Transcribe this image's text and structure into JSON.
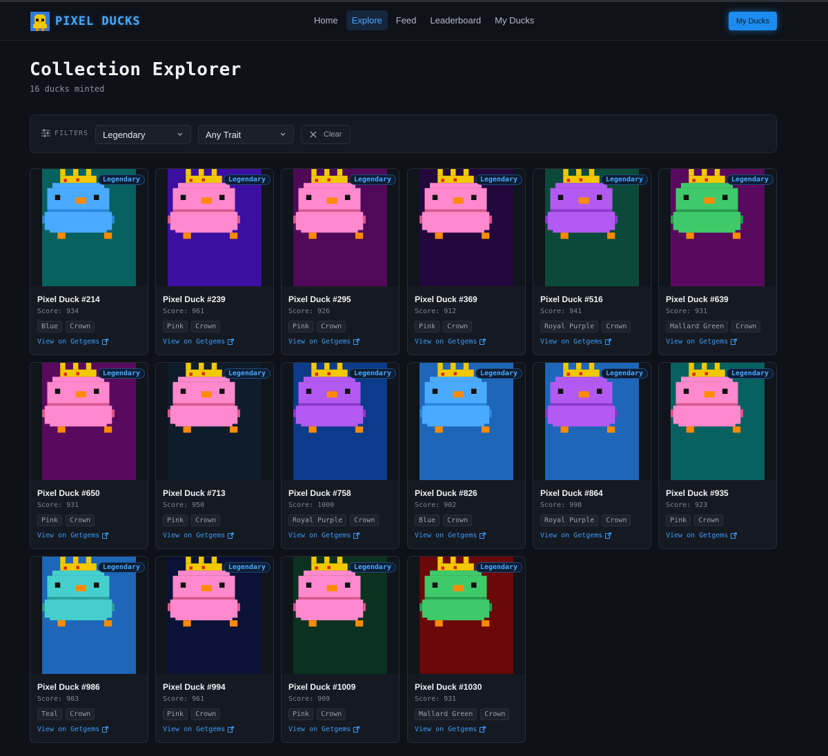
{
  "brand": {
    "name": "PIXEL DUCKS",
    "icon": "duck-logo-icon"
  },
  "nav": {
    "items": [
      {
        "label": "Home",
        "active": false
      },
      {
        "label": "Explore",
        "active": true
      },
      {
        "label": "Feed",
        "active": false
      },
      {
        "label": "Leaderboard",
        "active": false
      },
      {
        "label": "My Ducks",
        "active": false
      }
    ],
    "cta_label": "My Ducks"
  },
  "page": {
    "title": "Collection Explorer",
    "subtitle": "16 ducks minted"
  },
  "filters": {
    "label": "FILTERS",
    "rarity_value": "Legendary",
    "trait_value": "Any Trait",
    "clear_label": "Clear"
  },
  "colors": {
    "accent": "#4aa8ff",
    "background": "#0e1117",
    "card": "#151a22",
    "crown": "#f2c800",
    "beak": "#ff8a00"
  },
  "ducks": [
    {
      "name": "Pixel Duck #214",
      "score": "Score: 934",
      "tags": [
        "Blue",
        "Crown"
      ],
      "badge": "Legendary",
      "link": "View on Getgems",
      "bg": "#06615f",
      "body": "#4aaaff",
      "belt": "#2b87d8",
      "feet": "#ff8a00"
    },
    {
      "name": "Pixel Duck #239",
      "score": "Score: 961",
      "tags": [
        "Pink",
        "Crown"
      ],
      "badge": "Legendary",
      "link": "View on Getgems",
      "bg": "#3b0fa0",
      "body": "#ff89cc",
      "belt": "#d9578f",
      "feet": "#ff8a00"
    },
    {
      "name": "Pixel Duck #295",
      "score": "Score: 926",
      "tags": [
        "Pink",
        "Crown"
      ],
      "badge": "Legendary",
      "link": "View on Getgems",
      "bg": "#500958",
      "body": "#ff89cc",
      "belt": "#d9578f",
      "feet": "#ff8a00"
    },
    {
      "name": "Pixel Duck #369",
      "score": "Score: 912",
      "tags": [
        "Pink",
        "Crown"
      ],
      "badge": "Legendary",
      "link": "View on Getgems",
      "bg": "#22083c",
      "body": "#ff89cc",
      "belt": "#d9578f",
      "feet": "#ff8a00"
    },
    {
      "name": "Pixel Duck #516",
      "score": "Score: 941",
      "tags": [
        "Royal Purple",
        "Crown"
      ],
      "badge": "Legendary",
      "link": "View on Getgems",
      "bg": "#0b4a3a",
      "body": "#b35af2",
      "belt": "#8a39c9",
      "feet": "#ff8a00"
    },
    {
      "name": "Pixel Duck #639",
      "score": "Score: 931",
      "tags": [
        "Mallard Green",
        "Crown"
      ],
      "badge": "Legendary",
      "link": "View on Getgems",
      "bg": "#5a0a5e",
      "body": "#3fca6a",
      "belt": "#2a9a4d",
      "feet": "#ff8a00"
    },
    {
      "name": "Pixel Duck #650",
      "score": "Score: 931",
      "tags": [
        "Pink",
        "Crown"
      ],
      "badge": "Legendary",
      "link": "View on Getgems",
      "bg": "#5a0a5e",
      "body": "#ff89cc",
      "belt": "#d9578f",
      "feet": "#ff8a00"
    },
    {
      "name": "Pixel Duck #713",
      "score": "Score: 950",
      "tags": [
        "Pink",
        "Crown"
      ],
      "badge": "Legendary",
      "link": "View on Getgems",
      "bg": "#0f1c2c",
      "body": "#ff89cc",
      "belt": "#d9578f",
      "feet": "#ff8a00"
    },
    {
      "name": "Pixel Duck #758",
      "score": "Score: 1000",
      "tags": [
        "Royal Purple",
        "Crown"
      ],
      "badge": "Legendary",
      "link": "View on Getgems",
      "bg": "#0b3b8a",
      "body": "#b35af2",
      "belt": "#8a39c9",
      "feet": "#ff8a00"
    },
    {
      "name": "Pixel Duck #826",
      "score": "Score: 902",
      "tags": [
        "Blue",
        "Crown"
      ],
      "badge": "Legendary",
      "link": "View on Getgems",
      "bg": "#1d66b8",
      "body": "#4aaaff",
      "belt": "#2b87d8",
      "feet": "#ff8a00"
    },
    {
      "name": "Pixel Duck #864",
      "score": "Score: 998",
      "tags": [
        "Royal Purple",
        "Crown"
      ],
      "badge": "Legendary",
      "link": "View on Getgems",
      "bg": "#1d66b8",
      "body": "#b35af2",
      "belt": "#8a39c9",
      "feet": "#ff8a00"
    },
    {
      "name": "Pixel Duck #935",
      "score": "Score: 923",
      "tags": [
        "Pink",
        "Crown"
      ],
      "badge": "Legendary",
      "link": "View on Getgems",
      "bg": "#06615f",
      "body": "#ff89cc",
      "belt": "#d9578f",
      "feet": "#ff8a00"
    },
    {
      "name": "Pixel Duck #986",
      "score": "Score: 903",
      "tags": [
        "Teal",
        "Crown"
      ],
      "badge": "Legendary",
      "link": "View on Getgems",
      "bg": "#1d66b8",
      "body": "#45cfcc",
      "belt": "#2a9d9c",
      "feet": "#ff8a00"
    },
    {
      "name": "Pixel Duck #994",
      "score": "Score: 961",
      "tags": [
        "Pink",
        "Crown"
      ],
      "badge": "Legendary",
      "link": "View on Getgems",
      "bg": "#0a1236",
      "body": "#ff89cc",
      "belt": "#d9578f",
      "feet": "#ff8a00"
    },
    {
      "name": "Pixel Duck #1009",
      "score": "Score: 909",
      "tags": [
        "Pink",
        "Crown"
      ],
      "badge": "Legendary",
      "link": "View on Getgems",
      "bg": "#0b3220",
      "body": "#ff89cc",
      "belt": "#d9578f",
      "feet": "#ff8a00"
    },
    {
      "name": "Pixel Duck #1030",
      "score": "Score: 931",
      "tags": [
        "Mallard Green",
        "Crown"
      ],
      "badge": "Legendary",
      "link": "View on Getgems",
      "bg": "#6b0808",
      "body": "#3fca6a",
      "belt": "#2a9a4d",
      "feet": "#ff8a00"
    }
  ]
}
